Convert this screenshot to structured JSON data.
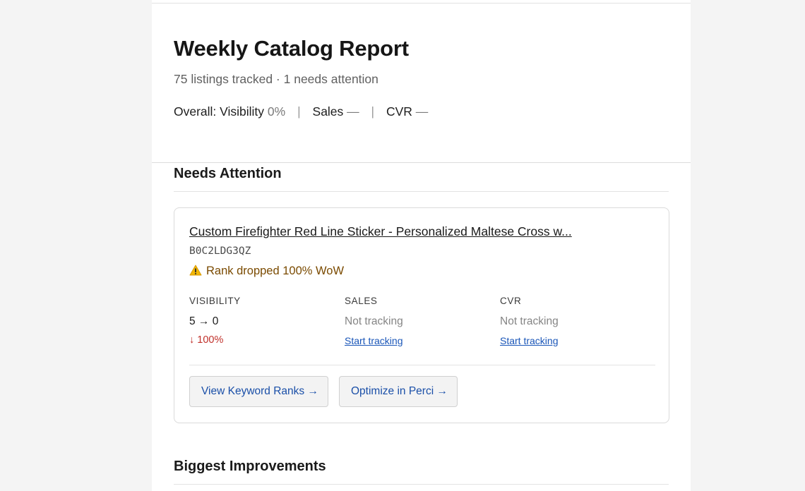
{
  "header": {
    "title": "Weekly Catalog Report",
    "subtitle": "75 listings tracked · 1 needs attention",
    "overall": {
      "visibility_label": "Overall: Visibility",
      "visibility_value": "0%",
      "separator": "|",
      "sales_label": "Sales",
      "sales_value": "—",
      "cvr_label": "CVR",
      "cvr_value": "—"
    }
  },
  "sections": {
    "needs_attention": "Needs Attention",
    "biggest_improvements": "Biggest Improvements"
  },
  "listing": {
    "title": "Custom Firefighter Red Line Sticker - Personalized Maltese Cross w...",
    "asin": "B0C2LDG3QZ",
    "warning_icon": "warning-icon",
    "warning_text": "Rank dropped 100% WoW",
    "metrics": {
      "visibility": {
        "label": "VISIBILITY",
        "value": "5 → 0",
        "delta": "↓ 100%"
      },
      "sales": {
        "label": "SALES",
        "value": "Not tracking",
        "link": "Start tracking"
      },
      "cvr": {
        "label": "CVR",
        "value": "Not tracking",
        "link": "Start tracking"
      }
    },
    "actions": {
      "keyword_ranks": "View Keyword Ranks →",
      "optimize": "Optimize in Perci →"
    }
  },
  "colors": {
    "link": "#1a56b8",
    "warning": "#7a4a00",
    "negative": "#c0302a",
    "button_text": "#1a4fa8"
  }
}
